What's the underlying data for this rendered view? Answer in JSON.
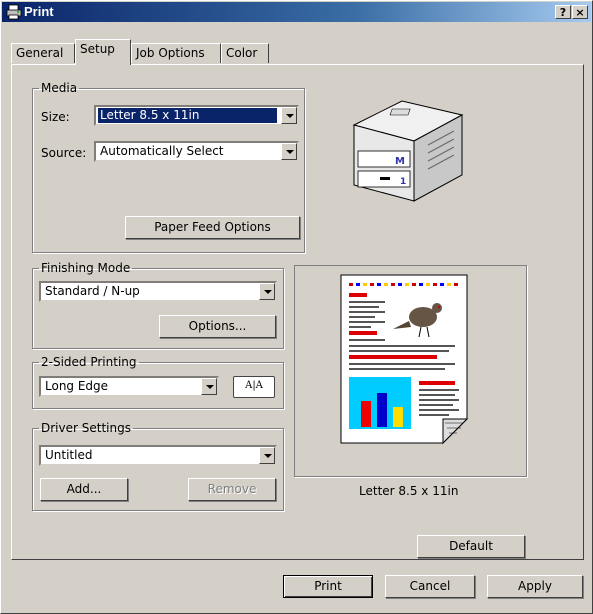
{
  "window": {
    "title": "Print",
    "help_label": "?",
    "close_label": "×"
  },
  "tabs": [
    {
      "label": "General"
    },
    {
      "label": "Setup"
    },
    {
      "label": "Job Options"
    },
    {
      "label": "Color"
    }
  ],
  "media": {
    "legend": "Media",
    "size_label": "Size:",
    "size_value": "Letter 8.5 x 11in",
    "source_label": "Source:",
    "source_value": "Automatically Select",
    "paper_feed_button": "Paper Feed Options"
  },
  "printer_badges": {
    "tray_letter": "M",
    "tray_number": "1"
  },
  "finishing": {
    "legend": "Finishing Mode",
    "value": "Standard / N-up",
    "options_button": "Options..."
  },
  "duplex": {
    "legend": "2-Sided Printing",
    "value": "Long Edge",
    "book_glyph": "A|A"
  },
  "driver": {
    "legend": "Driver Settings",
    "value": "Untitled",
    "add_button": "Add...",
    "remove_button": "Remove"
  },
  "preview": {
    "caption": "Letter 8.5 x 11in"
  },
  "default_button": "Default",
  "footer": {
    "print": "Print",
    "cancel": "Cancel",
    "apply": "Apply"
  },
  "colors": {
    "titlebar_start": "#0a246a",
    "titlebar_end": "#a6caf0",
    "face": "#d4d0c8",
    "selection": "#0a246a"
  }
}
